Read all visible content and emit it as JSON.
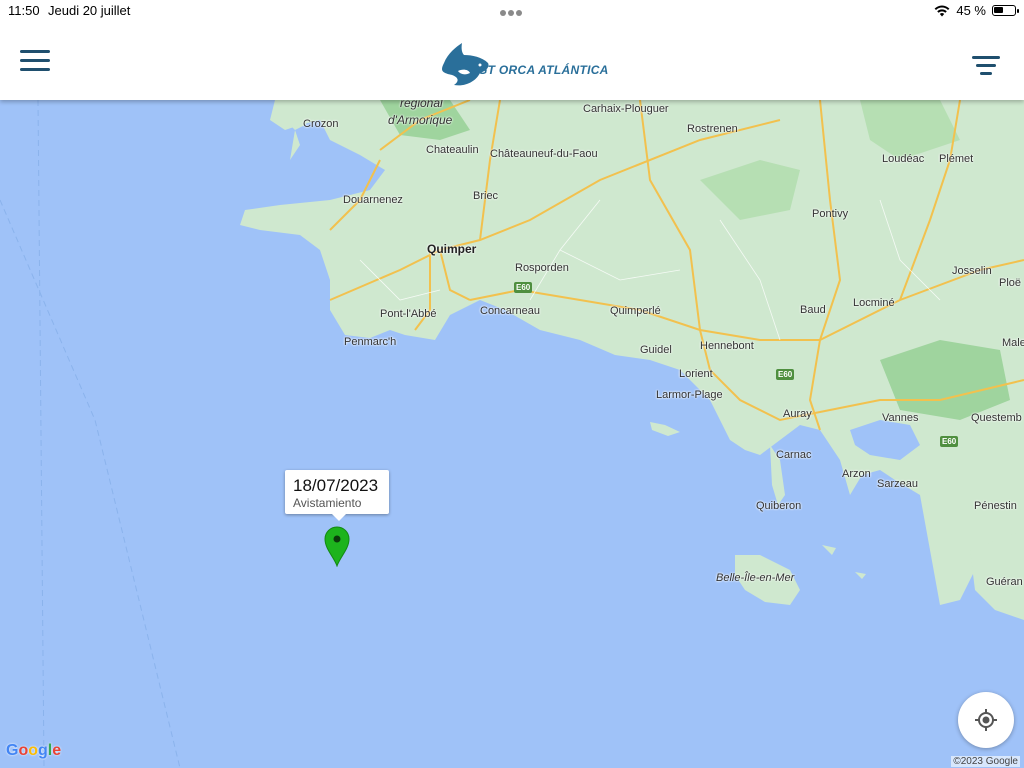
{
  "status_bar": {
    "time": "11:50",
    "date": "Jeudi 20 juillet",
    "battery_text": "45 %",
    "battery_level": 0.45
  },
  "header": {
    "logo_text": "GT ORCA ATLÁNTICA",
    "menu_icon": "hamburger-menu-icon",
    "filter_icon": "filter-icon"
  },
  "map": {
    "places": [
      {
        "name": "Crozon"
      },
      {
        "name": "regional"
      },
      {
        "name": "d'Armorique"
      },
      {
        "name": "Chateaulin"
      },
      {
        "name": "Châteauneuf-du-Faou"
      },
      {
        "name": "Carhaix-Plouguer"
      },
      {
        "name": "Rostrenen"
      },
      {
        "name": "Loudéac"
      },
      {
        "name": "Plémet"
      },
      {
        "name": "Douarnenez"
      },
      {
        "name": "Briec"
      },
      {
        "name": "Pontivy"
      },
      {
        "name": "Quimper"
      },
      {
        "name": "Rosporden"
      },
      {
        "name": "Josselin"
      },
      {
        "name": "Ploë"
      },
      {
        "name": "Pont-l'Abbé"
      },
      {
        "name": "Concarneau"
      },
      {
        "name": "Quimperlé"
      },
      {
        "name": "Baud"
      },
      {
        "name": "Locminé"
      },
      {
        "name": "Penmarc'h"
      },
      {
        "name": "Guidel"
      },
      {
        "name": "Hennebont"
      },
      {
        "name": "Male"
      },
      {
        "name": "Lorient"
      },
      {
        "name": "Larmor-Plage"
      },
      {
        "name": "Auray"
      },
      {
        "name": "Vannes"
      },
      {
        "name": "Questemb"
      },
      {
        "name": "Carnac"
      },
      {
        "name": "Arzon"
      },
      {
        "name": "Sarzeau"
      },
      {
        "name": "Quiberon"
      },
      {
        "name": "Pénestin"
      },
      {
        "name": "Belle-Île-en-Mer"
      },
      {
        "name": "Guéran"
      }
    ],
    "road_labels": [
      "E60",
      "E60",
      "E60"
    ],
    "colors": {
      "sea": "#9fc2f8",
      "land": "#cfe8cf",
      "roads": "#f2c14e",
      "marker": "#1db31d"
    }
  },
  "marker": {
    "date": "18/07/2023",
    "type": "Avistamiento"
  },
  "footer": {
    "google_logo": "Google",
    "copyright": "©2023 Google"
  },
  "controls": {
    "locate_icon": "my-location-icon"
  }
}
